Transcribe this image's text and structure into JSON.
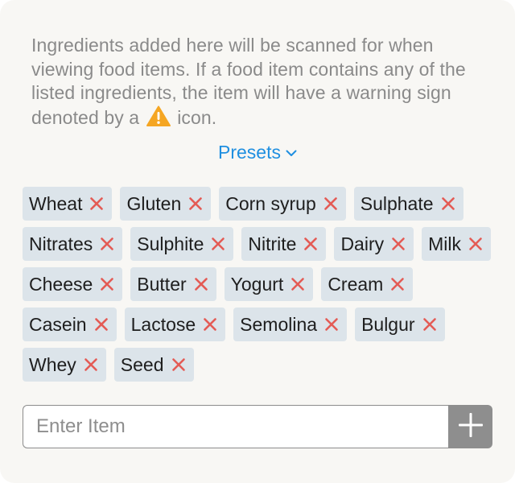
{
  "description": {
    "text_before_icon": "Ingredients added here will be scanned for when viewing food items. If a food item contains any of the listed ingredients, the item will have a warning sign denoted by a",
    "text_after_icon": "icon.",
    "icon": "warning-triangle-icon"
  },
  "presets": {
    "label": "Presets",
    "icon": "chevron-down-icon"
  },
  "ingredients": [
    "Wheat",
    "Gluten",
    "Corn syrup",
    "Sulphate",
    "Nitrates",
    "Sulphite",
    "Nitrite",
    "Dairy",
    "Milk",
    "Cheese",
    "Butter",
    "Yogurt",
    "Cream",
    "Casein",
    "Lactose",
    "Semolina",
    "Bulgur",
    "Whey",
    "Seed"
  ],
  "entry": {
    "placeholder": "Enter Item",
    "value": "",
    "add_icon": "plus-icon"
  },
  "colors": {
    "card_background": "#f8f7f4",
    "description_text": "#8a8a8a",
    "accent_link": "#1f8fe0",
    "tag_background": "#dce4ea",
    "remove_x": "#e45b55",
    "warning": "#f5a623",
    "add_button": "#8e8e8e"
  }
}
